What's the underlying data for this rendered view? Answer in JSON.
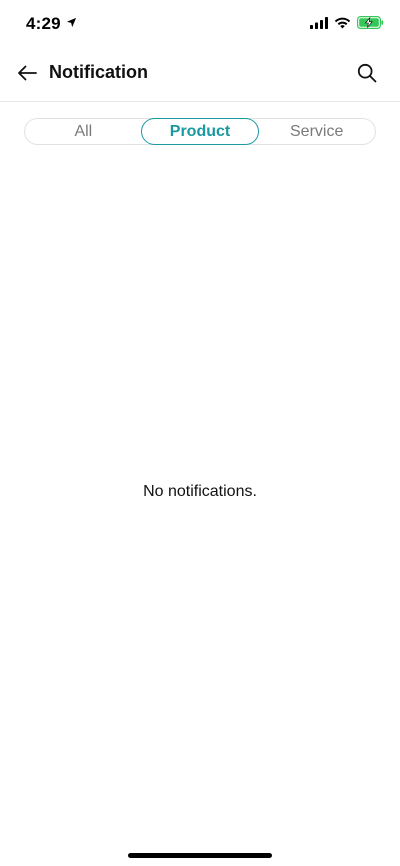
{
  "status_bar": {
    "time": "4:29",
    "icons": [
      "location-arrow-icon",
      "signal-icon",
      "wifi-icon",
      "battery-charging-icon"
    ],
    "battery_color": "#34c759"
  },
  "header": {
    "title": "Notification",
    "back_icon": "arrow-left-icon",
    "search_icon": "search-icon"
  },
  "tabs": {
    "items": [
      {
        "label": "All",
        "active": false
      },
      {
        "label": "Product",
        "active": true
      },
      {
        "label": "Service",
        "active": false
      }
    ],
    "accent_color": "#1a9aa0"
  },
  "content": {
    "empty_message": "No notifications."
  }
}
